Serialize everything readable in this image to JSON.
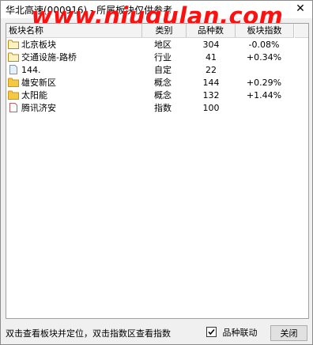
{
  "window": {
    "title": "华北高速(000916) - 所属板块仅供参考",
    "close_glyph": "✕"
  },
  "watermark": "www.niugulan.com",
  "table": {
    "headers": [
      "板块名称",
      "类别",
      "品种数",
      "板块指数"
    ],
    "rows": [
      {
        "name": "北京板块",
        "type": "地区",
        "count": "304",
        "index": "-0.08%",
        "icon": "folder-icon"
      },
      {
        "name": "交通设施-路桥",
        "type": "行业",
        "count": "41",
        "index": "+0.34%",
        "icon": "folder-icon"
      },
      {
        "name": "144.",
        "type": "自定",
        "count": "22",
        "index": "",
        "icon": "document-icon"
      },
      {
        "name": "雄安新区",
        "type": "概念",
        "count": "144",
        "index": "+0.29%",
        "icon": "folder-filled-icon"
      },
      {
        "name": "太阳能",
        "type": "概念",
        "count": "132",
        "index": "+1.44%",
        "icon": "folder-filled-icon"
      },
      {
        "name": "腾讯济安",
        "type": "指数",
        "count": "100",
        "index": "",
        "icon": "index-doc-icon"
      }
    ]
  },
  "status": {
    "hint": "双击查看板块并定位，双击指数区查看指数",
    "checkbox_label": "品种联动",
    "checkbox_checked": true,
    "close_label": "关闭"
  },
  "colors": {
    "watermark": "#ff1010",
    "folder": "#f5d56a",
    "folder_dark": "#d9a520"
  }
}
